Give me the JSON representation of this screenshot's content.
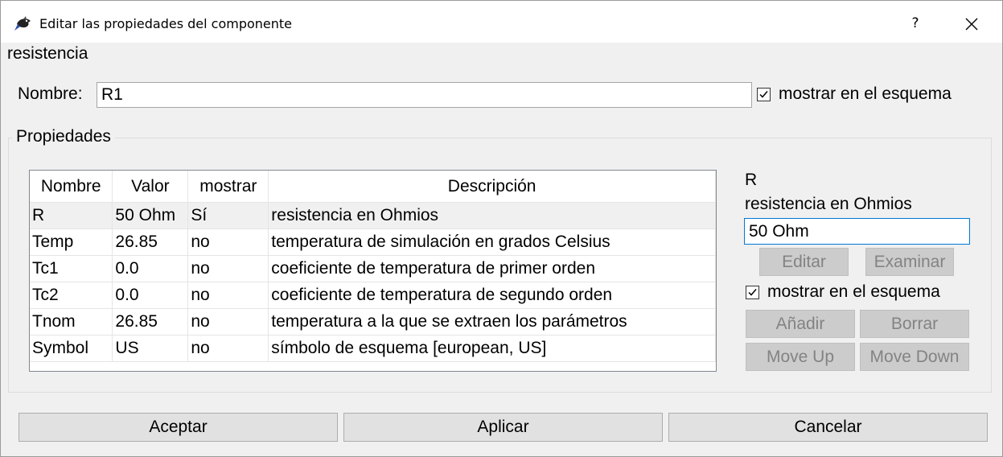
{
  "window": {
    "title": "Editar las propiedades del componente",
    "help_label": "?",
    "icons": {
      "app": "app-logo-icon",
      "close": "close-icon"
    }
  },
  "component_type": "resistencia",
  "name_row": {
    "label": "Nombre:",
    "value": "R1",
    "show_checkbox": {
      "label": "mostrar en el esquema",
      "checked": true
    }
  },
  "properties": {
    "group_title": "Propiedades",
    "columns": [
      "Nombre",
      "Valor",
      "mostrar",
      "Descripción"
    ],
    "rows": [
      {
        "name": "R",
        "value": "50 Ohm",
        "show": "Sí",
        "description": "resistencia en Ohmios",
        "selected": true
      },
      {
        "name": "Temp",
        "value": "26.85",
        "show": "no",
        "description": "temperatura de simulación en grados Celsius"
      },
      {
        "name": "Tc1",
        "value": "0.0",
        "show": "no",
        "description": "coeficiente de temperatura de primer orden"
      },
      {
        "name": "Tc2",
        "value": "0.0",
        "show": "no",
        "description": "coeficiente de temperatura de segundo orden"
      },
      {
        "name": "Tnom",
        "value": "26.85",
        "show": "no",
        "description": "temperatura a la que se extraen los parámetros"
      },
      {
        "name": "Symbol",
        "value": "US",
        "show": "no",
        "description": "símbolo de esquema [european, US]"
      }
    ]
  },
  "editor": {
    "prop_name": "R",
    "prop_description": "resistencia en Ohmios",
    "value": "50 Ohm",
    "edit_button": "Editar",
    "browse_button": "Examinar",
    "show_checkbox": {
      "label": "mostrar en el esquema",
      "checked": true
    },
    "add_button": "Añadir",
    "delete_button": "Borrar",
    "move_up_button": "Move Up",
    "move_down_button": "Move Down"
  },
  "footer": {
    "ok_button": "Aceptar",
    "apply_button": "Aplicar",
    "cancel_button": "Cancelar"
  },
  "colors": {
    "selected_row": "#f0f0f0",
    "focus_border": "#0078d7",
    "disabled_text": "#838383"
  }
}
